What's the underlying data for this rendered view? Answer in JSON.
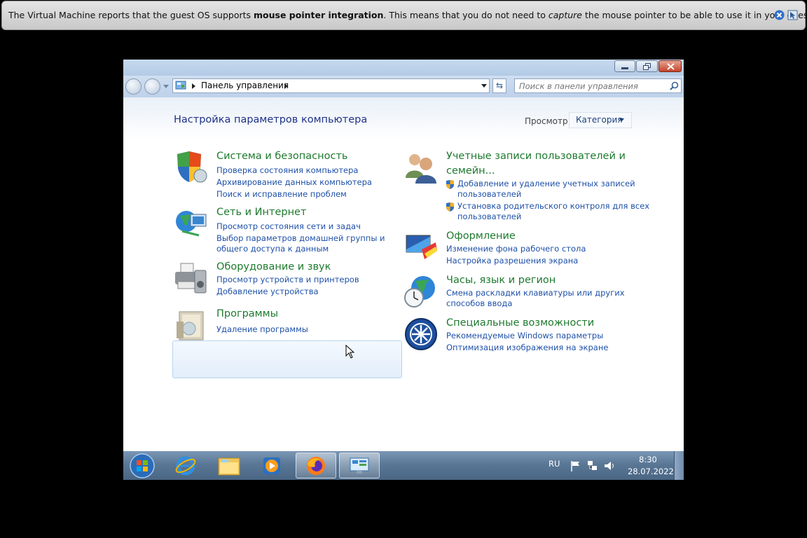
{
  "vm_notification": {
    "part1": "The Virtual Machine reports that the guest OS supports ",
    "bold": "mouse pointer integration",
    "part2": ". This means that you do not need to ",
    "italic": "capture",
    "part3": " the mouse pointer to be able to use it in your guest OS –"
  },
  "address": {
    "breadcrumb": "Панель управления"
  },
  "search": {
    "placeholder": "Поиск в панели управления"
  },
  "page": {
    "title": "Настройка параметров компьютера",
    "view_label": "Просмотр:",
    "view_value": "Категория"
  },
  "categories_left": [
    {
      "title": "Система и безопасность",
      "links": [
        "Проверка состояния компьютера",
        "Архивирование данных компьютера",
        "Поиск и исправление проблем"
      ]
    },
    {
      "title": "Сеть и Интернет",
      "links": [
        "Просмотр состояния сети и задач",
        "Выбор параметров домашней группы и",
        "общего доступа к данным"
      ]
    },
    {
      "title": "Оборудование и звук",
      "links": [
        "Просмотр устройств и принтеров",
        "Добавление устройства"
      ]
    },
    {
      "title": "Программы",
      "links": [
        "Удаление программы"
      ]
    }
  ],
  "categories_right": [
    {
      "title_line1": "Учетные записи пользователей и",
      "title_line2": "семейн...",
      "links": [
        "Добавление и удаление учетных записей",
        "пользователей",
        "Установка родительского контроля для всех",
        "пользователей"
      ]
    },
    {
      "title": "Оформление",
      "links": [
        "Изменение фона рабочего стола",
        "Настройка разрешения экрана"
      ]
    },
    {
      "title": "Часы, язык и регион",
      "links": [
        "Смена раскладки клавиатуры или других",
        "способов ввода"
      ]
    },
    {
      "title": "Специальные возможности",
      "links": [
        "Рекомендуемые Windows параметры",
        "Оптимизация изображения на экране"
      ]
    }
  ],
  "taskbar": {
    "language": "RU",
    "time": "8:30",
    "date": "28.07.2022"
  },
  "colors": {
    "heading_green": "#1e7a2e",
    "link_blue": "#1e50a8",
    "title_blue": "#1e3287"
  }
}
